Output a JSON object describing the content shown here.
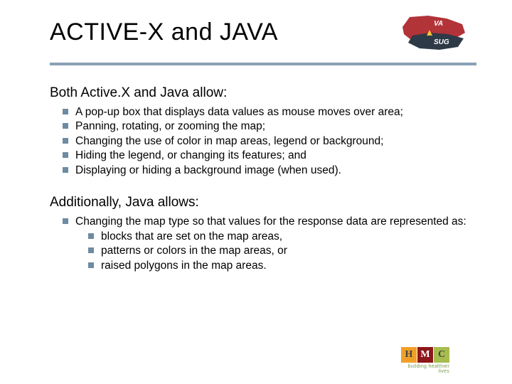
{
  "title": "ACTIVE-X and JAVA",
  "heading1": "Both Active.X and Java allow:",
  "list1": [
    "A pop-up box that displays data values as mouse moves over area;",
    "Panning, rotating, or zooming the map;",
    "Changing the use of color in map areas, legend or background;",
    "Hiding the legend, or changing its features; and",
    "Displaying or hiding a background image (when used)."
  ],
  "heading2": "Additionally, Java allows:",
  "list2": {
    "lead": "Changing the map type so that values for the response data are represented as:",
    "sub": [
      "blocks that are set on the map areas,",
      "patterns or colors in the map areas, or",
      "raised polygons in the map areas."
    ]
  },
  "logo_top": {
    "brand1": "VA",
    "brand2": "SUG"
  },
  "logo_bottom": {
    "letters": [
      "H",
      "M",
      "C"
    ],
    "tagline": "building healthier lives"
  }
}
